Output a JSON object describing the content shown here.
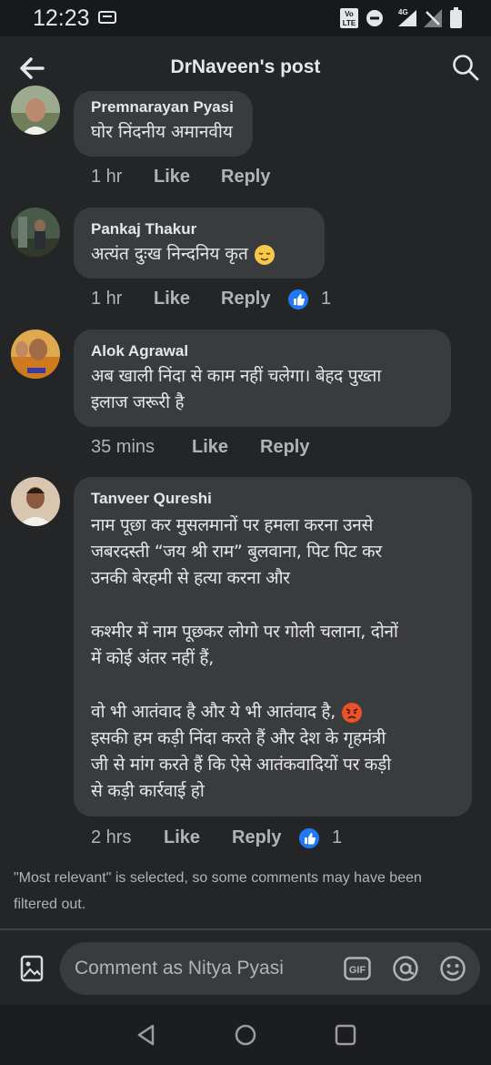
{
  "status_bar": {
    "time": "12:23",
    "icons": [
      "screenshot-icon",
      "volte-icon",
      "do-not-disturb-icon",
      "4g-signal-icon",
      "no-signal-icon",
      "battery-icon"
    ]
  },
  "header": {
    "title": "DrNaveen's post",
    "back_icon": "arrow-left-icon",
    "search_icon": "search-icon"
  },
  "comments": [
    {
      "name": "Premnarayan Pyasi",
      "text": [
        "घोर निंदनीय अमानवीय"
      ],
      "time": "1 hr",
      "like": "Like",
      "reply": "Reply",
      "reactions": ""
    },
    {
      "name": "Pankaj Thakur",
      "text": [
        "अत्यंत दुःख निन्दनिय कृत"
      ],
      "emoji": "relieved-face",
      "time": "1 hr",
      "like": "Like",
      "reply": "Reply",
      "reactions": "1"
    },
    {
      "name": "Alok Agrawal",
      "text": [
        "अब खाली निंदा से काम नहीं चलेगा। बेहद पुख्ता",
        "इलाज जरूरी है"
      ],
      "time": "35 mins",
      "like": "Like",
      "reply": "Reply",
      "reactions": ""
    },
    {
      "name": "Tanveer Qureshi",
      "text": [
        "नाम पूछा कर मुसलमानों पर हमला करना उनसे",
        "जबरदस्ती “जय श्री राम” बुलवाना, पिट पिट कर",
        "उनकी बेरहमी से हत्या करना और",
        "",
        "कश्मीर में नाम पूछकर लोगो पर गोली चलाना, दोनों",
        "में कोई अंतर नहीं हैं,",
        "",
        "वो भी आतंवाद है और ये भी आतंवाद है,",
        "इसकी हम कड़ी निंदा करते हैं और देश के गृहमंत्री",
        "जी से मांग करते हैं कि ऐसे आतंकवादियों पर कड़ी",
        "से कड़ी कार्रवाई हो"
      ],
      "emoji": "angry-face",
      "time": "2 hrs",
      "like": "Like",
      "reply": "Reply",
      "reactions": "1"
    }
  ],
  "notice": "\"Most relevant\" is selected, so some comments may have been filtered out.",
  "composer": {
    "placeholder": "Comment as Nitya Pyasi",
    "gif_label": "GIF"
  },
  "colors": {
    "background": "#242526",
    "bubble": "#3a3b3c",
    "like_blue": "#2078f4",
    "secondary_text": "#b0b3b8"
  }
}
